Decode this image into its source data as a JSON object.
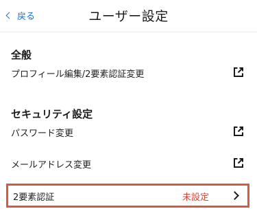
{
  "nav": {
    "back_label": "戻る",
    "title": "ユーザー設定"
  },
  "sections": {
    "general": {
      "header": "全般",
      "items": [
        {
          "label": "プロフィール編集/2要素認証変更",
          "icon": "external-link-icon"
        }
      ]
    },
    "security": {
      "header": "セキュリティ設定",
      "items": [
        {
          "label": "パスワード変更",
          "icon": "external-link-icon"
        },
        {
          "label": "メールアドレス変更",
          "icon": "external-link-icon"
        }
      ]
    },
    "two_factor": {
      "label": "2要素認証",
      "status": "未設定",
      "icon": "chevron-right-icon"
    }
  },
  "colors": {
    "accent": "#1a6fd6",
    "status_unset": "#d9473a",
    "highlight_border": "#d45a47"
  }
}
